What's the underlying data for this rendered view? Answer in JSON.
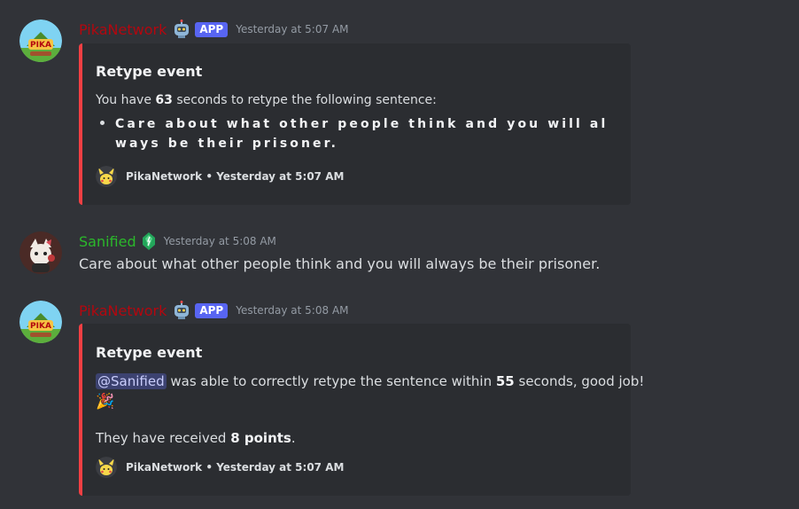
{
  "messages": [
    {
      "author": "PikaNetwork",
      "app_badge": "APP",
      "timestamp": "Yesterday at 5:07 AM",
      "embed": {
        "title": "Retype event",
        "text_pre": "You have ",
        "text_bold": "63",
        "text_post": " seconds to retype the following sentence:",
        "bullet_line1": "Care about what other people think and you will al",
        "bullet_line2": "ways be their prisoner.",
        "footer_name": "PikaNetwork",
        "footer_sep": "•",
        "footer_time": "Yesterday at 5:07 AM"
      }
    },
    {
      "author": "Sanified",
      "timestamp": "Yesterday at 5:08 AM",
      "text": "Care about what other people think and you will always be their prisoner."
    },
    {
      "author": "PikaNetwork",
      "app_badge": "APP",
      "timestamp": "Yesterday at 5:08 AM",
      "embed": {
        "title": "Retype event",
        "mention": "@Sanified",
        "text_mid": " was able to correctly retype the sentence within ",
        "text_bold": "55",
        "text_post": " seconds, good job!",
        "emoji": "🎉",
        "points_pre": "They have received ",
        "points_bold": "8 points",
        "points_post": ".",
        "footer_name": "PikaNetwork",
        "footer_sep": "•",
        "footer_time": "Yesterday at 5:07 AM"
      }
    }
  ],
  "colors": {
    "background": "#313338",
    "embed_bg": "#2b2d31",
    "embed_border": "#f23f43",
    "pika_name": "#b3070f",
    "sanified_name": "#2bb82b",
    "app_badge": "#5865f2"
  },
  "icons": {
    "pika_avatar": "pikanetwork-logo-avatar",
    "sanified_avatar": "user-avatar",
    "bot_emoji": "robot-emoji-icon",
    "role_badge": "green-gem-icon",
    "footer_icon": "pikachu-icon",
    "party_emoji": "party-popper-icon"
  }
}
